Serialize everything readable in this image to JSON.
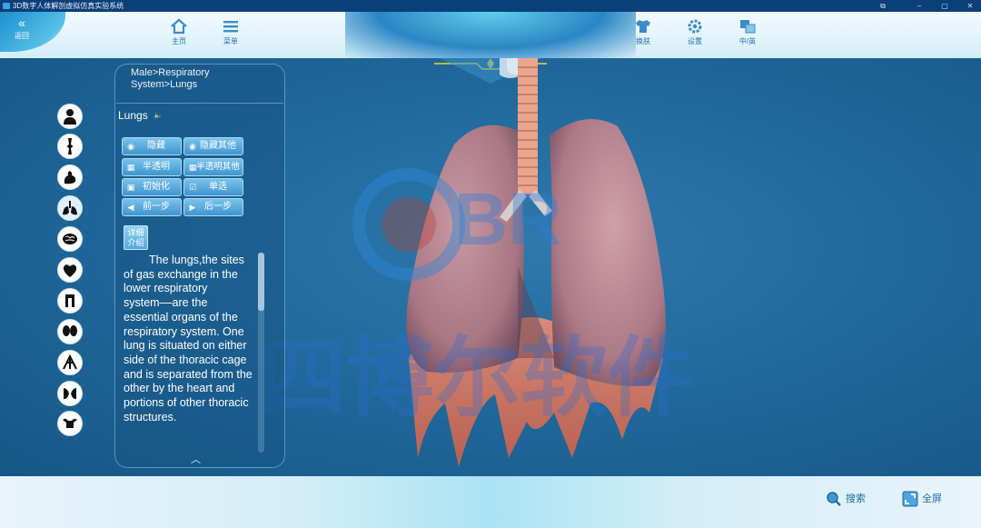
{
  "titlebar": {
    "title": "3D数字人体解剖虚拟仿真实验系统",
    "controls": [
      "⧉",
      "–",
      "▢",
      "✕"
    ]
  },
  "back": {
    "label": "返回"
  },
  "toolbar": {
    "home_label": "主页",
    "menu_label": "菜单",
    "skin_label": "换肤",
    "settings_label": "设置",
    "lang_label": "中/英"
  },
  "systems": [
    "skin",
    "skeleton",
    "muscle",
    "respiratory",
    "nervous",
    "cardiovascular",
    "digestive",
    "urinary",
    "lymphatic",
    "endocrine",
    "reproductive"
  ],
  "panel": {
    "breadcrumb_line1": "Male>Respiratory",
    "breadcrumb_line2": "System>Lungs",
    "organ_title": "Lungs",
    "buttons": {
      "hide": "隐藏",
      "hide_others": "隐藏其他",
      "translucent": "半透明",
      "translucent_others": "半透明其他",
      "initialize": "初始化",
      "single_select": "单选",
      "prev_step": "前一步",
      "next_step": "后一步"
    },
    "detail_line1": "详细",
    "detail_line2": "介绍",
    "description": "The lungs,the sites of gas exchange in the lower respiratory system––are the essential organs of the respiratory system. One lung is situated on either side of the thoracic cage and is separated from the other by the heart and portions of other thoracic structures."
  },
  "watermark": {
    "logo_text": "BR",
    "cn_text": "四博尔软件"
  },
  "bottom": {
    "search_label": "搜索",
    "fullscreen_label": "全屏"
  },
  "colors": {
    "accent": "#3f95cf",
    "viewport": "#206a9c",
    "lung": "#c98f99",
    "trachea": "#e8a48c"
  }
}
